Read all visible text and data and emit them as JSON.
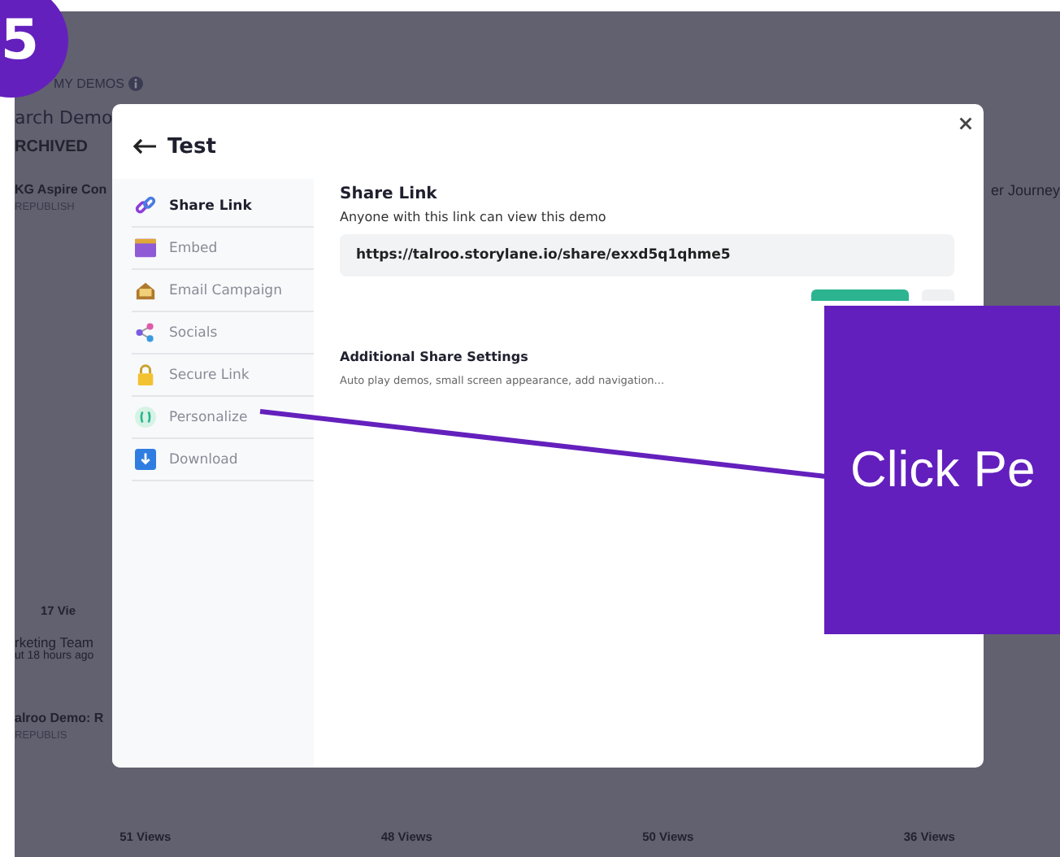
{
  "step_badge": "5",
  "dashboard": {
    "tab": "MY DEMOS",
    "search": {
      "placeholder": "arch Demo"
    },
    "filter": "RCHIVED",
    "left_column": [
      {
        "kind": "title",
        "text": "KG Aspire Con"
      },
      {
        "kind": "status",
        "text": "REPUBLISH"
      },
      {
        "kind": "views",
        "text": "17 Vie"
      },
      {
        "kind": "team",
        "text": "rketing Team"
      },
      {
        "kind": "meta",
        "text": "ut 18 hours ago"
      },
      {
        "kind": "title",
        "text": "alroo Demo: R"
      },
      {
        "kind": "status",
        "text": "REPUBLIS"
      }
    ],
    "right_card_title": "er Journey",
    "footer_views": [
      "51 Views",
      "48 Views",
      "50 Views",
      "36 Views"
    ]
  },
  "modal": {
    "title": "Test",
    "menu": [
      {
        "kind": "link",
        "label": "Share Link",
        "selected": true
      },
      {
        "kind": "embed",
        "label": "Embed",
        "selected": false
      },
      {
        "kind": "email",
        "label": "Email Campaign",
        "selected": false
      },
      {
        "kind": "socials",
        "label": "Socials",
        "selected": false
      },
      {
        "kind": "lock",
        "label": "Secure Link",
        "selected": false
      },
      {
        "kind": "personalize",
        "label": "Personalize",
        "selected": false
      },
      {
        "kind": "download",
        "label": "Download",
        "selected": false
      }
    ],
    "share": {
      "title": "Share Link",
      "description": "Anyone with this link can view this demo",
      "url": "https://talroo.storylane.io/share/exxd5q1qhme5"
    },
    "settings": {
      "title": "Additional Share Settings",
      "description": "Auto play demos, small screen appearance, add navigation..."
    }
  },
  "callout": {
    "text": "Click Pe"
  }
}
